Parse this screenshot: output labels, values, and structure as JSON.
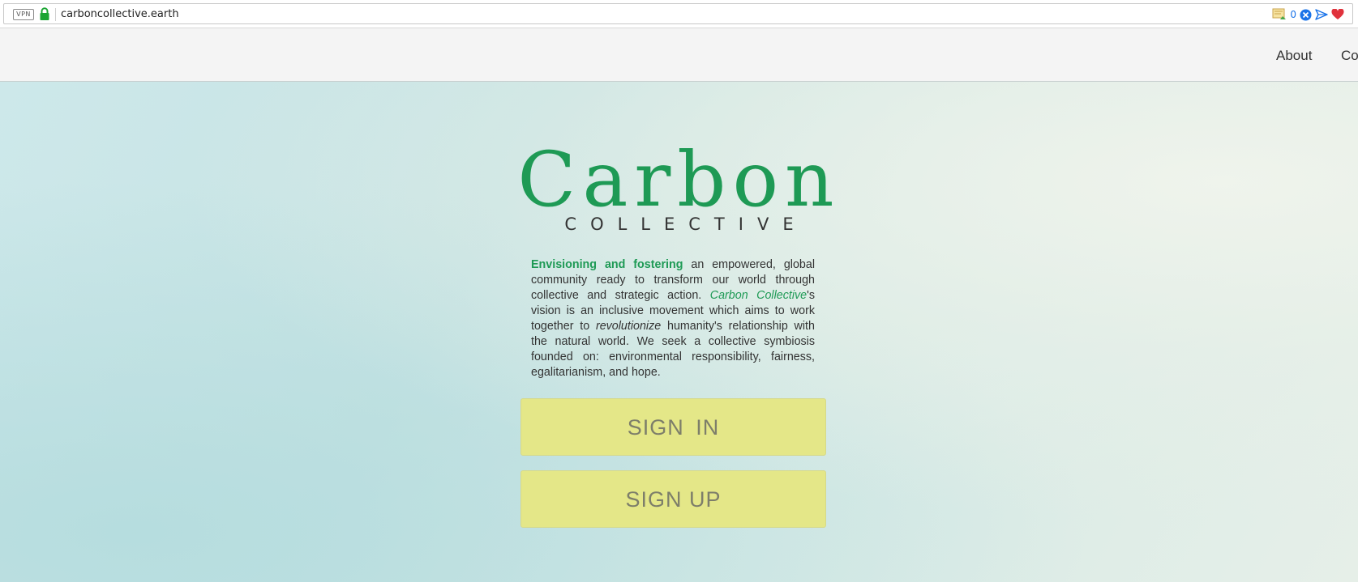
{
  "browser": {
    "vpn_label": "VPN",
    "url": "carboncollective.earth",
    "blocked_count": "0"
  },
  "nav": {
    "items": [
      {
        "label": "About"
      },
      {
        "label": "Co"
      }
    ]
  },
  "hero": {
    "title": "Carbon",
    "subtitle": "COLLECTIVE",
    "mission": {
      "lead": "Envisioning and fostering",
      "part1": " an empowered, global community ready to transform our world through collective and strategic action. ",
      "brand": "Carbon Collective",
      "part2": "'s vision is an inclusive movement which aims to work together to ",
      "emphasis": "revolutionize",
      "part3": " humanity's relationship with the natural world. We seek a collective symbiosis founded on: environmental responsibility, fairness, egalitarianism, and hope."
    },
    "sign_in_label": "SIGN IN",
    "sign_up_label": "SIGN UP"
  },
  "colors": {
    "brand_green": "#1e9a55",
    "button_yellow": "#e4e788",
    "button_text": "#7d7e6a",
    "header_bg": "#f4f4f4"
  }
}
